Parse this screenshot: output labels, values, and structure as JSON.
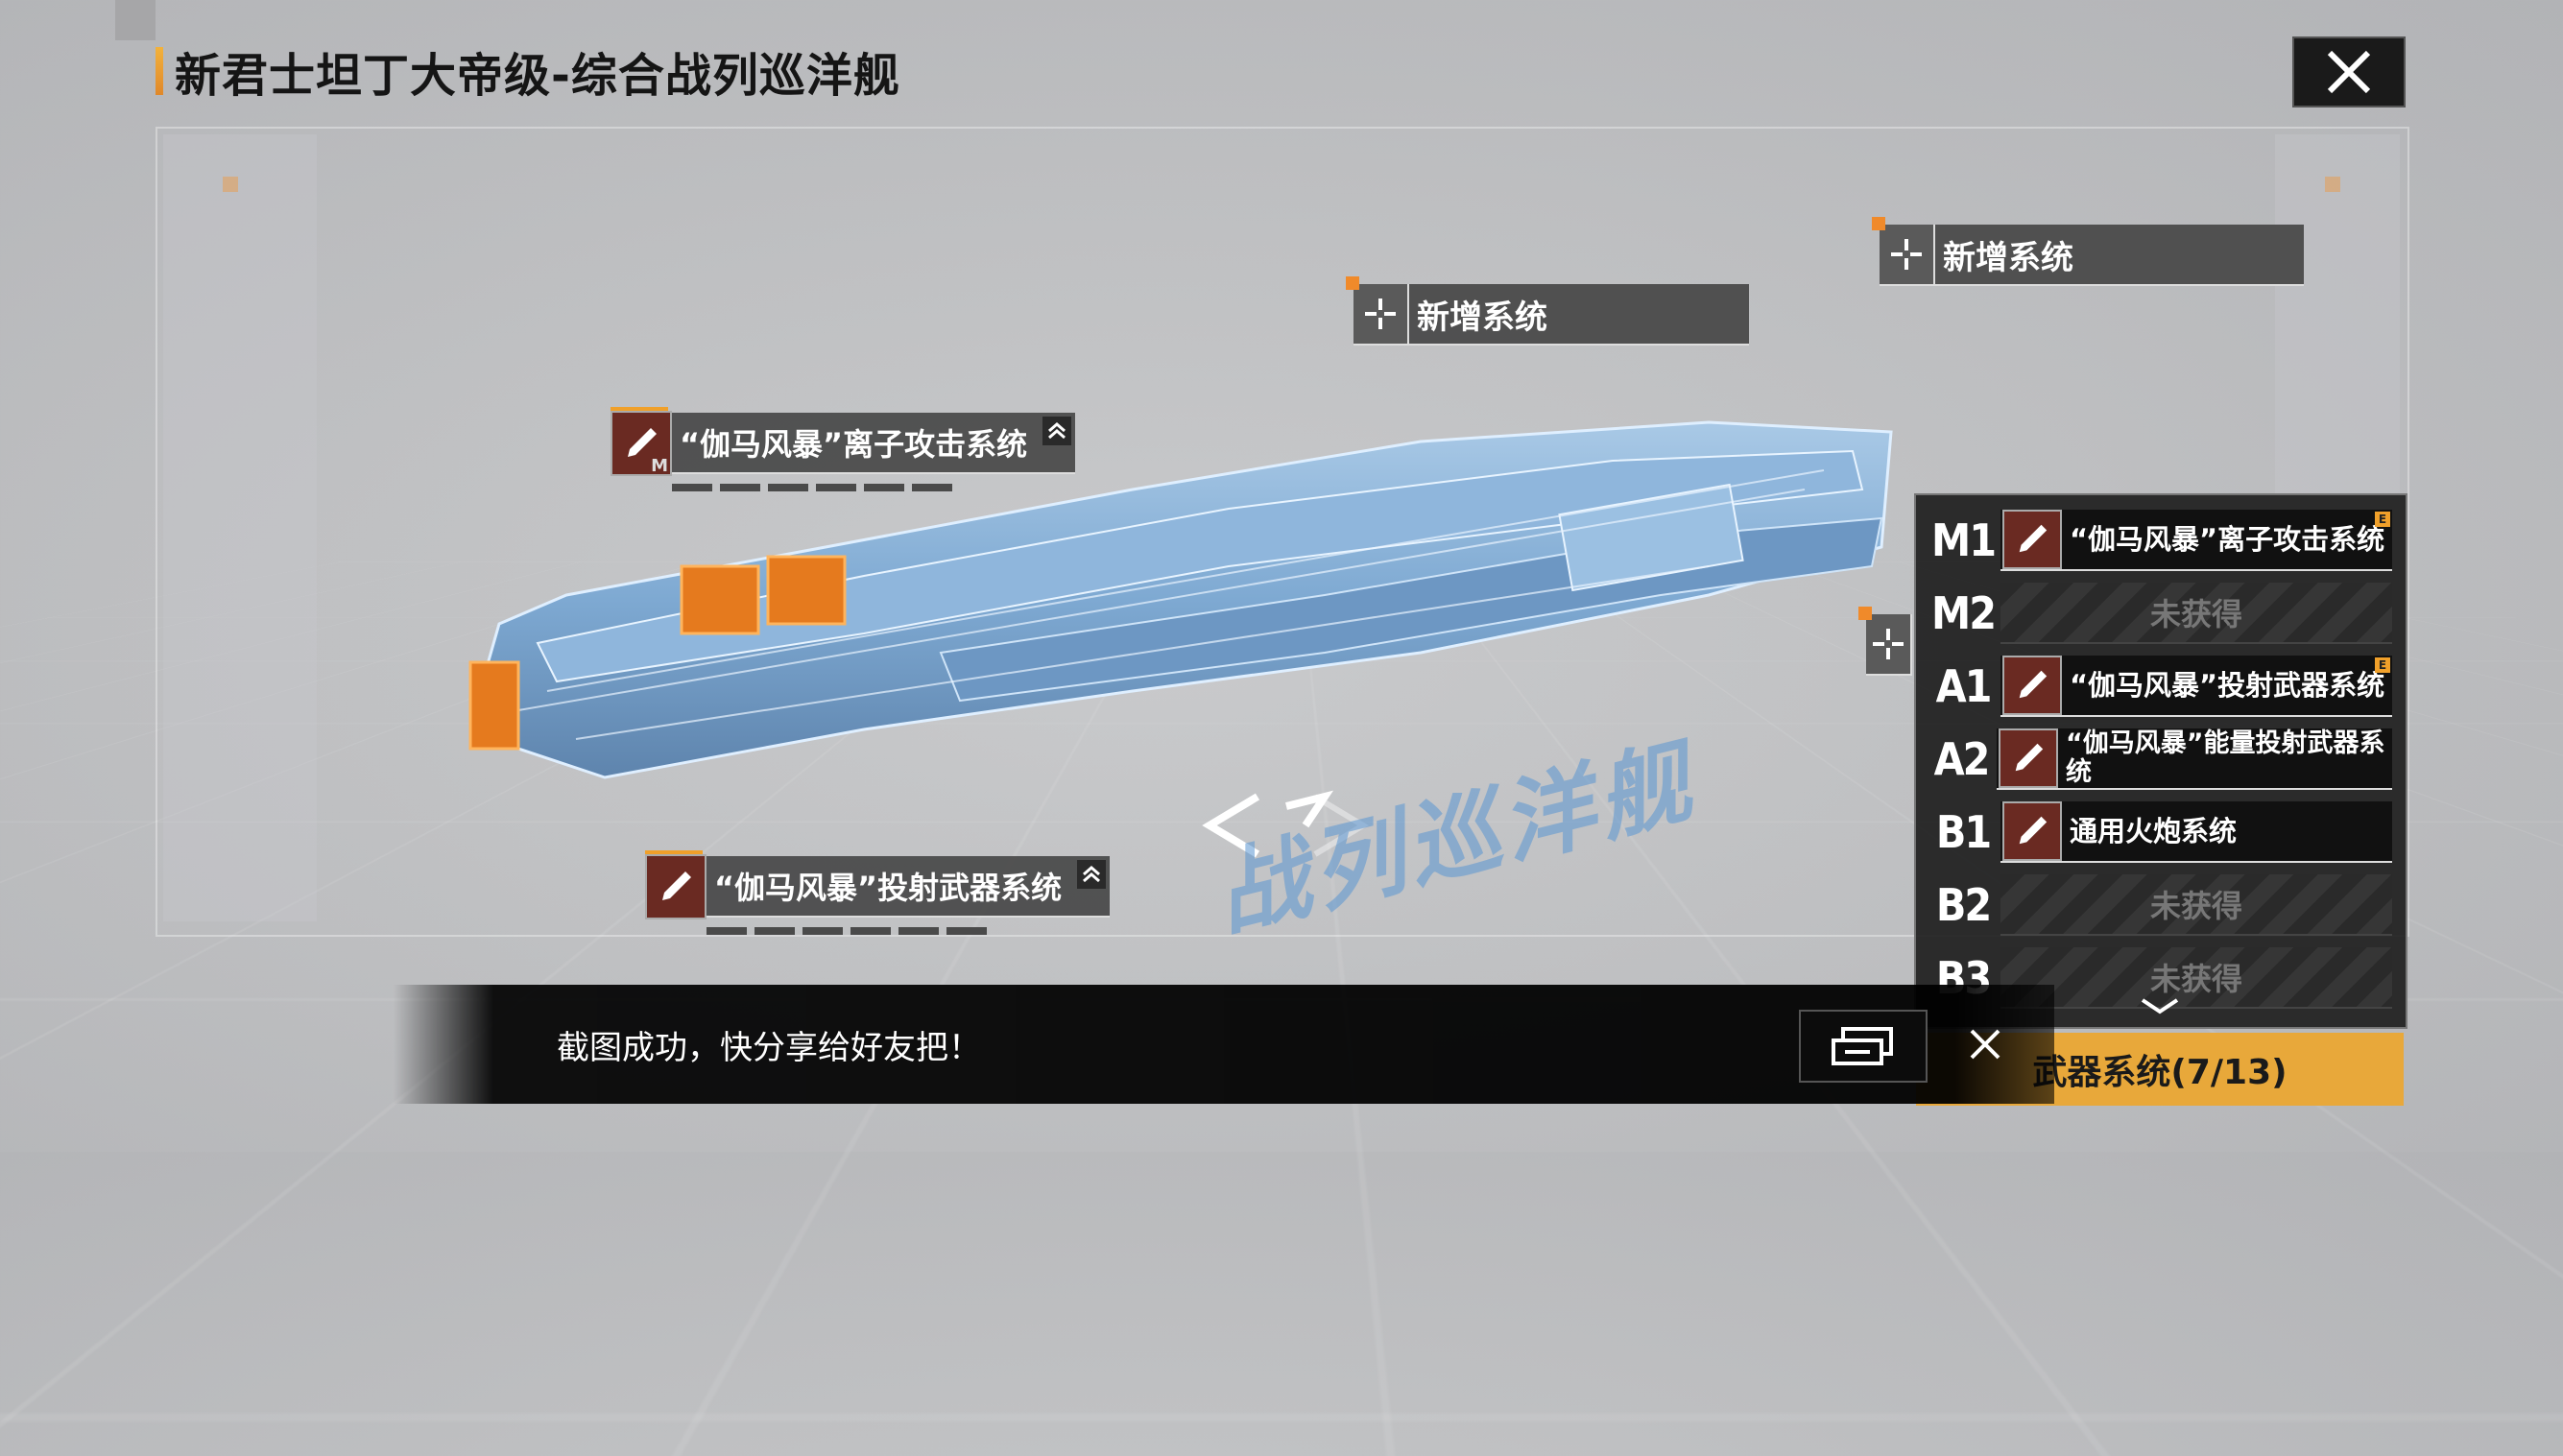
{
  "title": "新君士坦丁大帝级-综合战列巡洋舰",
  "watermark": "战列巡洋舰",
  "add_tags": [
    {
      "label": "新增系统"
    },
    {
      "label": "新增系统"
    }
  ],
  "weapon_tags": [
    {
      "label": "“伽马风暴”离子攻击系统",
      "badge": "M"
    },
    {
      "label": "“伽马风暴”投射武器系统",
      "badge": ""
    }
  ],
  "slots": [
    {
      "slot": "M1",
      "name": "“伽马风暴”离子攻击系统",
      "equipped": true,
      "badge": "E"
    },
    {
      "slot": "M2",
      "name": "未获得",
      "equipped": false
    },
    {
      "slot": "A1",
      "name": "“伽马风暴”投射武器系统",
      "equipped": true,
      "badge": "E"
    },
    {
      "slot": "A2",
      "name": "“伽马风暴”能量投射武器系统",
      "equipped": true,
      "badge": ""
    },
    {
      "slot": "B1",
      "name": "通用火炮系统",
      "equipped": true,
      "badge": ""
    },
    {
      "slot": "B2",
      "name": "未获得",
      "equipped": false
    },
    {
      "slot": "B3",
      "name": "未获得",
      "equipped": false
    }
  ],
  "weapon_button": "武器系统(7/13)",
  "toast": {
    "message": "截图成功，快分享给好友把！"
  },
  "colors": {
    "accent": "#e8a83a",
    "weapon_icon_bg": "#6a2a22",
    "ship": "#7faed8"
  }
}
